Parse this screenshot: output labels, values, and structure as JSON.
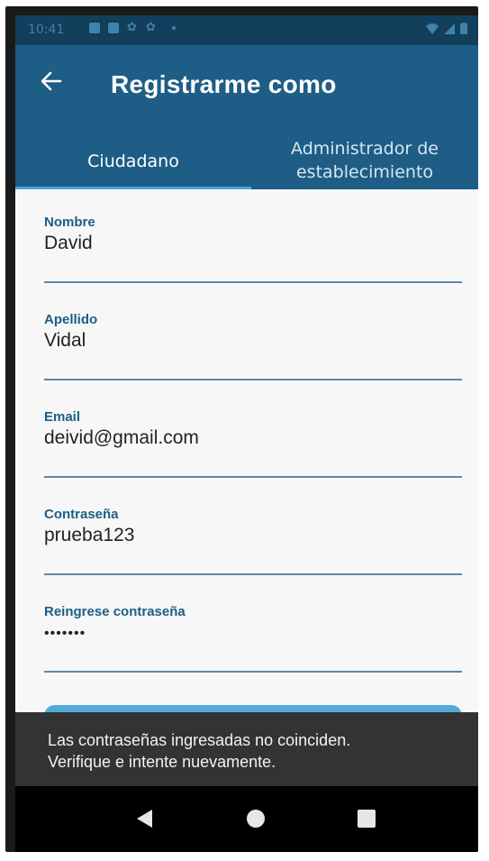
{
  "status_bar": {
    "time": "10:41"
  },
  "app_bar": {
    "title": "Registrarme como"
  },
  "tabs": [
    {
      "label": "Ciudadano",
      "selected": true
    },
    {
      "label": "Administrador de establecimiento",
      "line1": "Administrador de",
      "line2": "establecimiento",
      "selected": false
    }
  ],
  "form": {
    "fields": [
      {
        "label": "Nombre",
        "value": "David"
      },
      {
        "label": "Apellido",
        "value": "Vidal"
      },
      {
        "label": "Email",
        "value": "deivid@gmail.com"
      },
      {
        "label": "Contraseña",
        "value": "prueba123"
      },
      {
        "label": "Reingrese contraseña",
        "value": "•••••••"
      }
    ]
  },
  "snackbar": {
    "line1": "Las contraseñas ingresadas no coinciden.",
    "line2": "Verifique e intente nuevamente."
  },
  "colors": {
    "app_bar": "#1d5d86",
    "status_bar": "#123f5c",
    "indicator": "#4aa3de",
    "submit_button": "#55a9d9",
    "snackbar": "#333333"
  },
  "icons": {
    "back": "arrow-left-icon",
    "nav_back": "triangle-left-icon",
    "nav_home": "circle-icon",
    "nav_recents": "square-icon"
  }
}
